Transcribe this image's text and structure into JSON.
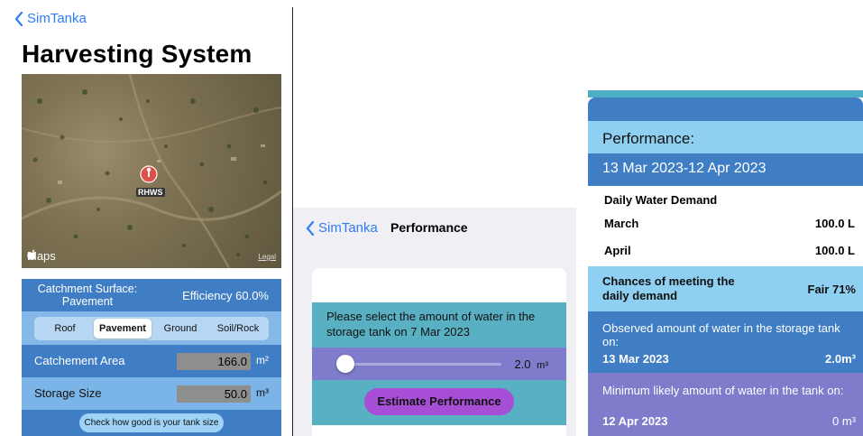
{
  "colors": {
    "accent_blue": "#2f7cf6",
    "dark_blue": "#3f7ec4",
    "light_blue": "#8fd0f2",
    "teal": "#58b0c2",
    "violet": "#7f7ccc",
    "button_purple": "#a64fd6"
  },
  "screen1": {
    "back_label": "SimTanka",
    "title": "Harvesting System",
    "map": {
      "pin_label": "RHWS",
      "maps_label": "Maps",
      "legal_label": "Legal",
      "pin_icon": "map-pin-icon"
    },
    "catchment": {
      "label": "Catchment Surface: Pavement",
      "efficiency": "Efficiency 60.0%"
    },
    "surface_segments": [
      {
        "label": "Roof",
        "selected": false
      },
      {
        "label": "Pavement",
        "selected": true
      },
      {
        "label": "Ground",
        "selected": false
      },
      {
        "label": "Soil/Rock",
        "selected": false
      }
    ],
    "catchment_area": {
      "label": "Catchement Area",
      "value": "166.0",
      "unit": "m²"
    },
    "storage_size": {
      "label": "Storage Size",
      "value": "50.0",
      "unit": "m³"
    },
    "check_button": "Check how good is your tank size"
  },
  "screen2": {
    "back_label": "SimTanka",
    "title": "Performance",
    "prompt": "Please select the amount of water in the storage tank on 7 Mar 2023",
    "slider_value": "2.0",
    "slider_unit": "m³",
    "slider_fraction": 0.04,
    "estimate_button": "Estimate Performance"
  },
  "screen3": {
    "performance_label": "Performance:",
    "date_range": "13 Mar 2023-12 Apr 2023",
    "demand_title": "Daily Water Demand",
    "months": [
      {
        "name": "March",
        "value": "100.0 L"
      },
      {
        "name": "April",
        "value": "100.0 L"
      }
    ],
    "chance_label": "Chances of meeting the daily demand",
    "chance_value": "Fair 71%",
    "observed_label": "Observed amount of water in the storage tank on:",
    "observed_date": "13 Mar 2023",
    "observed_value": "2.0m³",
    "minimum_label": "Minimum likely amount of water in the tank on:",
    "minimum_date": "12 Apr 2023",
    "minimum_value": "0 m³"
  }
}
